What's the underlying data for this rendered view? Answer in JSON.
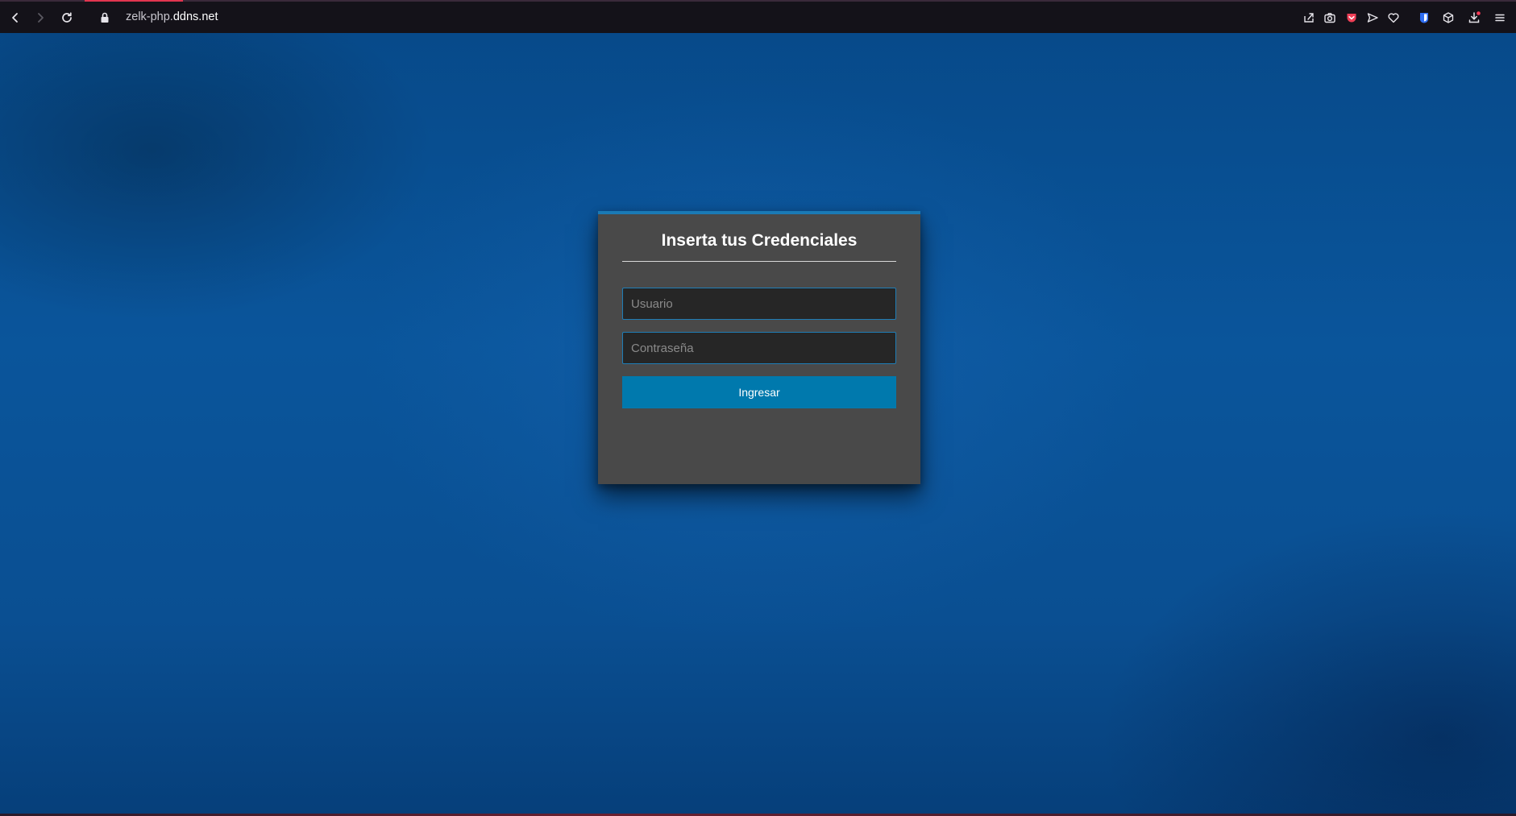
{
  "browser": {
    "url_prefix": "zelk-php.",
    "url_host": "ddns.net",
    "icons": {
      "back": "back-arrow-icon",
      "forward": "forward-arrow-icon",
      "reload": "reload-icon",
      "lock": "lock-icon",
      "share": "share-icon",
      "screenshot": "camera-icon",
      "pocket": "pocket-icon",
      "send": "send-icon",
      "favorite": "heart-icon",
      "bitwarden": "bitwarden-icon",
      "extension": "cube-icon",
      "downloads": "download-icon",
      "menu": "hamburger-menu-icon"
    },
    "accent_color": "#e2354f"
  },
  "login": {
    "title": "Inserta tus Credenciales",
    "username_placeholder": "Usuario",
    "password_placeholder": "Contraseña",
    "submit_label": "Ingresar",
    "accent_color": "#0079ad",
    "card_color": "#494949"
  }
}
